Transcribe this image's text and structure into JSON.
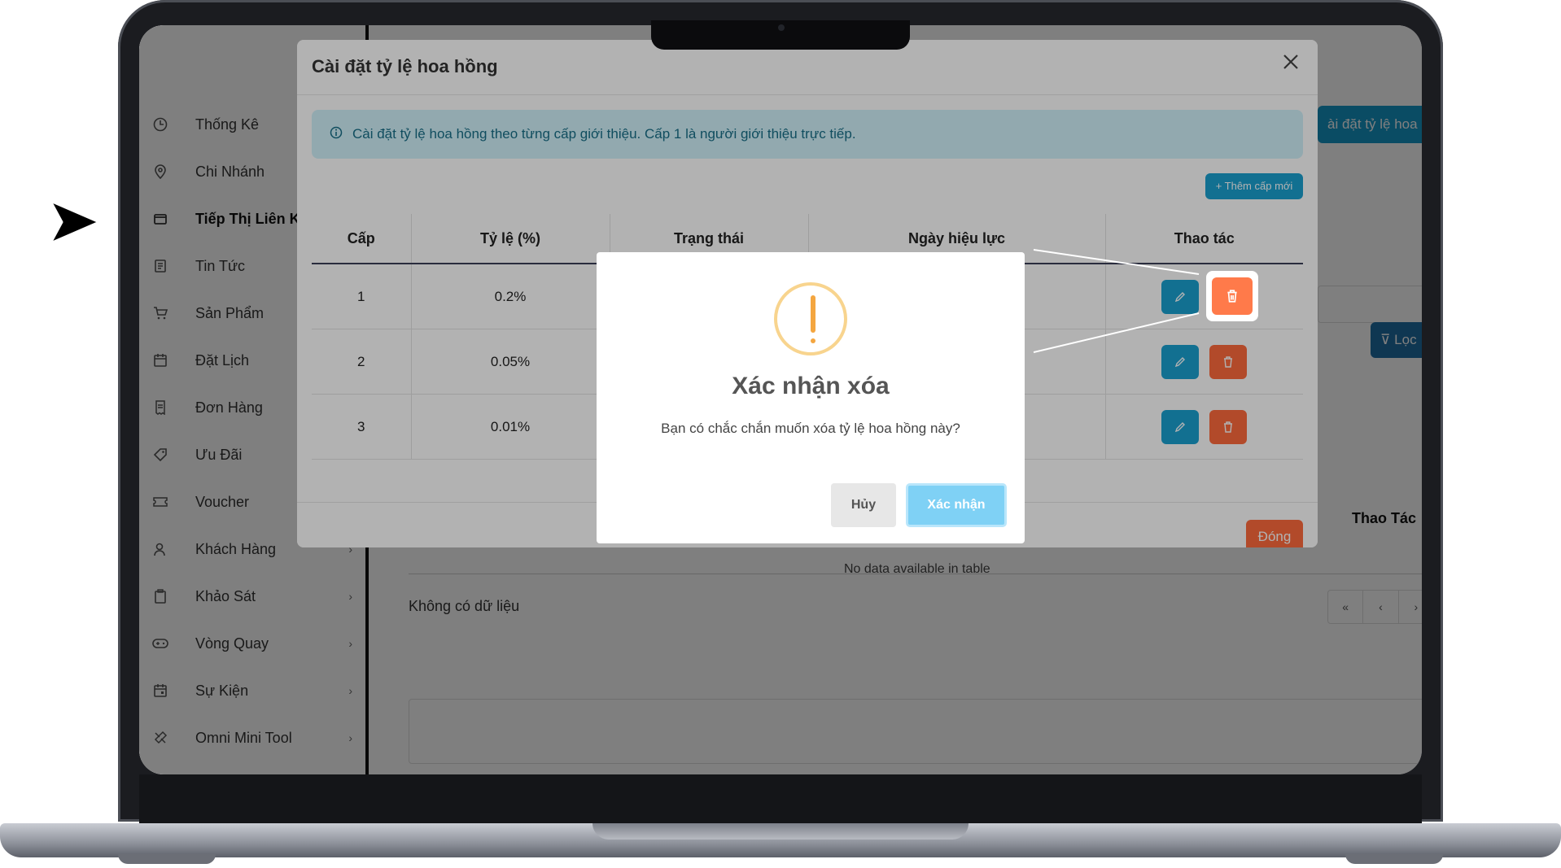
{
  "sidebar": {
    "items": [
      {
        "label": "Thống Kê",
        "icon": "clock-icon"
      },
      {
        "label": "Chi Nhánh",
        "icon": "location-pin-icon"
      },
      {
        "label": "Tiếp Thị Liên Kết",
        "icon": "wallet-icon"
      },
      {
        "label": "Tin Tức",
        "icon": "news-icon"
      },
      {
        "label": "Sản Phẩm",
        "icon": "cart-icon"
      },
      {
        "label": "Đặt Lịch",
        "icon": "calendar-icon"
      },
      {
        "label": "Đơn Hàng",
        "icon": "receipt-icon"
      },
      {
        "label": "Ưu Đãi",
        "icon": "tag-icon"
      },
      {
        "label": "Voucher",
        "icon": "ticket-icon"
      },
      {
        "label": "Khách Hàng",
        "icon": "user-icon"
      },
      {
        "label": "Khảo Sát",
        "icon": "clipboard-icon"
      },
      {
        "label": "Vòng Quay",
        "icon": "gamepad-icon"
      },
      {
        "label": "Sự Kiện",
        "icon": "event-calendar-icon"
      },
      {
        "label": "Omni Mini Tool",
        "icon": "tool-icon"
      }
    ]
  },
  "background": {
    "top_button": "ài đặt tỷ lệ hoa hồ",
    "filter_button": "Lọc",
    "column_header": "Thao Tác",
    "no_data_table": "No data available in table",
    "empty_text": "Không có dữ liệu",
    "pager": [
      "«",
      "‹",
      "›"
    ]
  },
  "modal": {
    "title": "Cài đặt tỷ lệ hoa hồng",
    "info": "Cài đặt tỷ lệ hoa hồng theo từng cấp giới thiệu. Cấp 1 là người giới thiệu trực tiếp.",
    "add_button": "+ Thêm cấp mới",
    "columns": [
      "Cấp",
      "Tỷ lệ (%)",
      "Trạng thái",
      "Ngày hiệu lực",
      "Thao tác"
    ],
    "rows": [
      {
        "level": "1",
        "rate": "0.2%"
      },
      {
        "level": "2",
        "rate": "0.05%"
      },
      {
        "level": "3",
        "rate": "0.01%"
      }
    ],
    "close_button": "Đóng"
  },
  "confirm": {
    "title": "Xác nhận xóa",
    "message": "Bạn có chắc chắn muốn xóa tỷ lệ hoa hồng này?",
    "cancel": "Hủy",
    "ok": "Xác nhận"
  },
  "colors": {
    "primary": "#1aa1d0",
    "danger": "#ff6a3d",
    "warning": "#f4a640"
  }
}
